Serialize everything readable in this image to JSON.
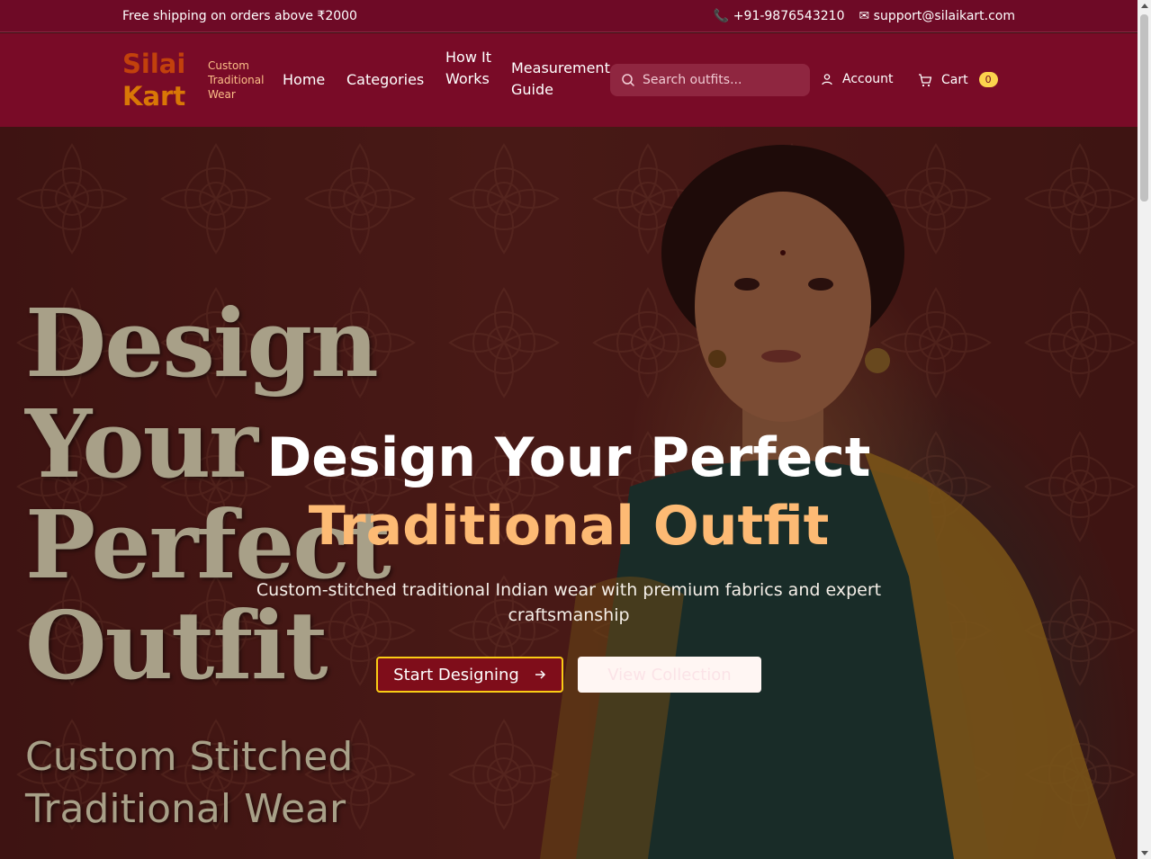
{
  "topbar": {
    "promo": "Free shipping on orders above ₹2000",
    "phone": "📞 +91-9876543210",
    "email": "✉ support@silaikart.com"
  },
  "header": {
    "logo_line1": "Silai",
    "logo_line2": "Kart",
    "tagline": "Custom Traditional Wear",
    "nav": {
      "home": "Home",
      "categories": "Categories",
      "how_it_works": "How It Works",
      "measurement_guide": "Measurement Guide"
    },
    "search_placeholder": "Search outfits...",
    "account_label": "Account",
    "cart_label": "Cart",
    "cart_count": "0",
    "icons": [
      "search-icon",
      "user-icon",
      "cart-icon"
    ]
  },
  "hero": {
    "art_title": "Design Your Perfect Outfit",
    "art_subtitle": "Custom Stitched Traditional Wear",
    "headline_line1": "Design Your Perfect",
    "headline_line2": "Traditional Outfit",
    "subtext": "Custom-stitched traditional Indian wear with premium fabrics and expert craftsmanship",
    "primary_button": "Start Designing",
    "secondary_button": "View Collection",
    "icons": [
      "arrow-right-icon"
    ]
  },
  "colors": {
    "topbar_bg": "#6e0a26",
    "header_bg": "#790b27",
    "accent_orange": "#fdba74",
    "logo_orange": "#c2410c",
    "logo_amber": "#d97706",
    "button_border": "#facc15",
    "badge_bg": "#fcd34d"
  }
}
